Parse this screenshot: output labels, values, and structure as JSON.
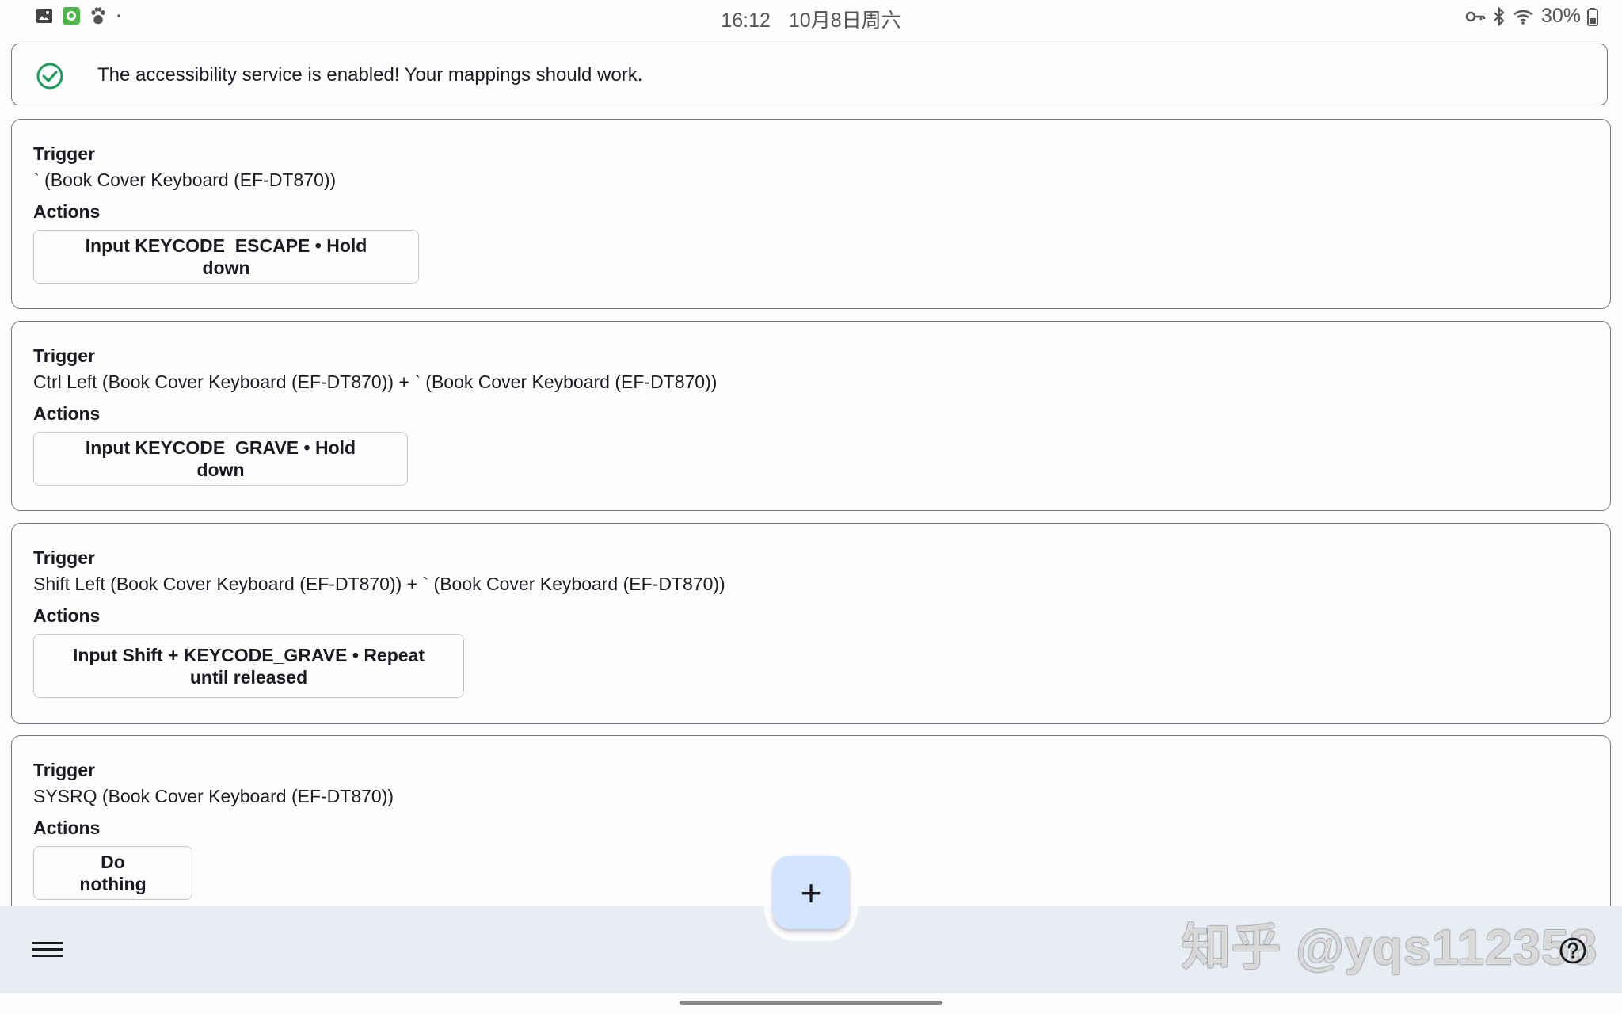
{
  "status_bar": {
    "time": "16:12",
    "date": "10月8日周六",
    "battery": "30%",
    "left_icons": [
      "gallery-icon",
      "app-icon",
      "baidu-icon",
      "dot-icon"
    ],
    "right_icons": [
      "key-icon",
      "bluetooth-icon",
      "wifi-icon",
      "battery-icon"
    ]
  },
  "banner": {
    "message": "The accessibility service is enabled! Your mappings should work.",
    "icon": "check-circle-icon",
    "icon_color": "#1e9c5e"
  },
  "labels": {
    "trigger": "Trigger",
    "actions": "Actions"
  },
  "mappings": [
    {
      "trigger": "` (Book Cover Keyboard (EF-DT870))",
      "action": "Input KEYCODE_ESCAPE • Hold down"
    },
    {
      "trigger": "Ctrl Left (Book Cover Keyboard (EF-DT870)) + ` (Book Cover Keyboard (EF-DT870))",
      "action": "Input KEYCODE_GRAVE • Hold down"
    },
    {
      "trigger": "Shift Left (Book Cover Keyboard (EF-DT870)) + ` (Book Cover Keyboard (EF-DT870))",
      "action_line1": "Input Shift + KEYCODE_GRAVE • Repeat",
      "action_line2": "until released"
    },
    {
      "trigger": "SYSRQ (Book Cover Keyboard (EF-DT870))",
      "action": "Do nothing"
    }
  ],
  "fab": {
    "label": "+",
    "icon": "add-icon"
  },
  "bottom_bar": {
    "menu_icon": "menu-icon",
    "help_icon": "help-icon",
    "watermark": "知乎 @yqs112358"
  },
  "colors": {
    "fab_bg": "#d3e4ff",
    "bottom_bar_bg": "#e8edf4",
    "outline": "#74777f"
  }
}
